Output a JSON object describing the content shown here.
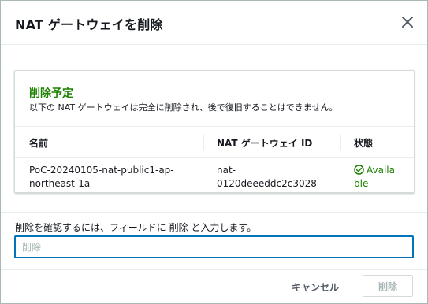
{
  "dialog": {
    "title": "NAT ゲートウェイを削除",
    "close_icon": "close-icon"
  },
  "notice": {
    "heading": "削除予定",
    "description": "以下の NAT ゲートウェイは完全に削除され、後で復旧することはできません。"
  },
  "table": {
    "columns": [
      "名前",
      "NAT ゲートウェイ ID",
      "状態"
    ],
    "rows": [
      {
        "name_line1": "PoC-20240105-nat-public1-ap-",
        "name_line2": "northeast-1a",
        "id_line1": "nat-",
        "id_line2": "0120deeeddc2c3028",
        "status_line1": "Availa",
        "status_line2": "ble",
        "status_icon": "check-circle-icon"
      }
    ]
  },
  "confirm": {
    "label": "削除を確認するには、フィールドに 削除 と入力します。",
    "value": "",
    "placeholder": "削除"
  },
  "footer": {
    "cancel_label": "キャンセル",
    "delete_label": "削除"
  },
  "colors": {
    "success": "#1d8102",
    "focus": "#0073bb",
    "disabled_text": "#aab7b8"
  }
}
